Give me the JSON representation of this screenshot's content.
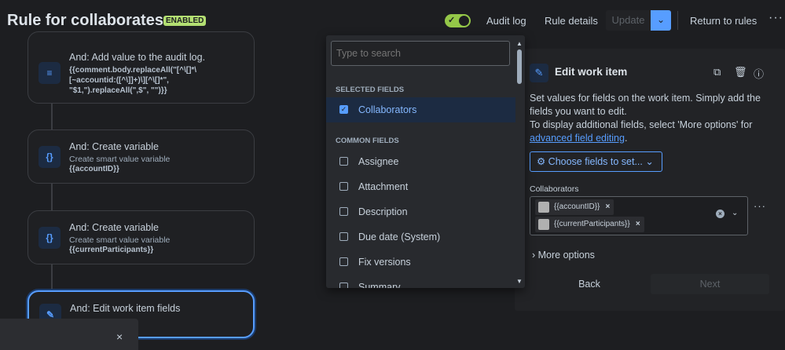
{
  "header": {
    "title": "Rule for collaborates",
    "status_badge": "ENABLED",
    "toggle_check": "✓",
    "audit_log": "Audit log",
    "rule_details": "Rule details",
    "update": "Update",
    "update_chevron": "⌄",
    "return": "Return to rules",
    "more": "···"
  },
  "canvas": {
    "cards": [
      {
        "title": "And: Add value to the audit log.",
        "body_lines": [
          "{{comment.body.replaceAll(\"[^\\[]*\\",
          "[~accountid:([^\\]]+)\\][^\\[]*\",",
          "\"$1,\").replaceAll(\",$\", \"\")}}"
        ],
        "icon": "≡"
      },
      {
        "title": "And: Create variable",
        "subtitle": "Create smart value variable",
        "value": "{{accountID}}",
        "icon": "{}"
      },
      {
        "title": "And: Create variable",
        "subtitle": "Create smart value variable",
        "value": "{{currentParticipants}}",
        "icon": "{}"
      },
      {
        "title": "And: Edit work item fields",
        "icon": "✎"
      }
    ],
    "toast_close": "×"
  },
  "dropdown": {
    "search_placeholder": "Type to search",
    "selected_header": "SELECTED FIELDS",
    "selected": [
      {
        "label": "Collaborators",
        "checked": true
      }
    ],
    "common_header": "COMMON FIELDS",
    "common": [
      {
        "label": "Assignee"
      },
      {
        "label": "Attachment"
      },
      {
        "label": "Description"
      },
      {
        "label": "Due date (System)"
      },
      {
        "label": "Fix versions"
      },
      {
        "label": "Summary"
      }
    ],
    "check": "✓"
  },
  "panel": {
    "title": "Edit work item",
    "desc1": "Set values for fields on the work item. Simply add the fields you want to edit.",
    "desc2": "To display additional fields, select 'More options' for ",
    "desc_link": "advanced field editing",
    "desc_end": ".",
    "choose_button": "⚙ Choose fields to set... ⌄",
    "field_label": "Collaborators",
    "chips": [
      "{{accountID}}",
      "{{currentParticipants}}"
    ],
    "chip_remove": "×",
    "clear": "×",
    "chevron": "⌄",
    "field_more": "···",
    "more_options": "› More options",
    "back": "Back",
    "next": "Next"
  }
}
